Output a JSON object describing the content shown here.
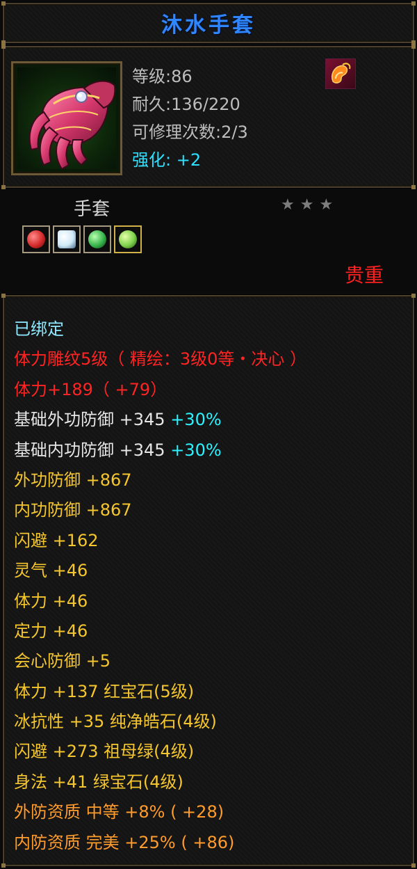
{
  "item": {
    "name": "沐水手套",
    "level": "等级:86",
    "durability": "耐久:136/220",
    "repair": "可修理次数:2/3",
    "enhance": "强化: +2",
    "type": "手套",
    "rarity": "贵重",
    "stars": [
      "★",
      "★",
      "★"
    ],
    "icon": "gauntlet-icon",
    "type_icon": "flame-fist-icon",
    "gems": [
      {
        "icon": "red-gem-icon",
        "color": "#d42a2a"
      },
      {
        "icon": "white-gem-icon",
        "color": "#cfe9f7"
      },
      {
        "icon": "emerald-gem-icon",
        "color": "#37b54a"
      },
      {
        "icon": "green-gem-icon",
        "color": "#7bd14a"
      }
    ]
  },
  "attributes": {
    "bound": "已绑定",
    "engrave": "体力雕纹5级（ 精绘：3级0等・决心 ）",
    "stamina_total": "体力+189（ +79）",
    "base_ext_def": "基础外功防御 +345",
    "base_ext_def_pct": "+30%",
    "base_int_def": "基础内功防御 +345",
    "base_int_def_pct": "+30%",
    "ext_def": "外功防御 +867",
    "int_def": "内功防御 +867",
    "dodge": "闪避 +162",
    "spirit": "灵气 +46",
    "stamina": "体力 +46",
    "focus": "定力 +46",
    "crit_def": "会心防御 +5",
    "gem1": "体力 +137 红宝石(5级)",
    "gem2": "冰抗性 +35 纯净皓石(4级)",
    "gem3": "闪避 +273 祖母绿(4级)",
    "gem4": "身法 +41 绿宝石(4级)",
    "ext_quality": "外防资质  中等 +8% ( +28)",
    "int_quality": "内防资质  完美 +25% ( +86)"
  }
}
